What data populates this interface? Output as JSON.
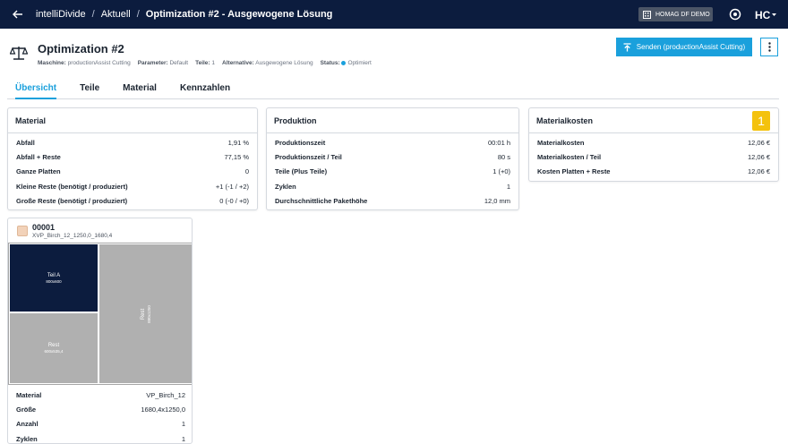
{
  "topbar": {
    "app": "intelliDivide",
    "crumb": "Aktuell",
    "current": "Optimization #2 - Ausgewogene Lösung",
    "tenant": "HOMAG DF DEMO"
  },
  "header": {
    "title": "Optimization #2",
    "meta": [
      {
        "label": "Maschine:",
        "value": "productionAssist Cutting"
      },
      {
        "label": "Parameter:",
        "value": "Default"
      },
      {
        "label": "Teile:",
        "value": "1"
      },
      {
        "label": "Alternative:",
        "value": "Ausgewogene Lösung"
      },
      {
        "label": "Status:",
        "value": "Optimiert"
      }
    ],
    "send_label": "Senden (productionAssist Cutting)"
  },
  "tabs": [
    "Übersicht",
    "Teile",
    "Material",
    "Kennzahlen"
  ],
  "cards": {
    "material": {
      "title": "Material",
      "rows": [
        {
          "k": "Abfall",
          "v": "1,91 %"
        },
        {
          "k": "Abfall + Reste",
          "v": "77,15 %"
        },
        {
          "k": "Ganze Platten",
          "v": "0"
        },
        {
          "k": "Kleine Reste (benötigt / produziert)",
          "v": "+1 (-1 / +2)"
        },
        {
          "k": "Große Reste (benötigt / produziert)",
          "v": "0 (-0 / +0)"
        }
      ]
    },
    "produktion": {
      "title": "Produktion",
      "rows": [
        {
          "k": "Produktionszeit",
          "v": "00:01 h"
        },
        {
          "k": "Produktionszeit / Teil",
          "v": "80 s"
        },
        {
          "k": "Teile (Plus Teile)",
          "v": "1 (+0)"
        },
        {
          "k": "Zyklen",
          "v": "1"
        },
        {
          "k": "Durchschnittliche Pakethöhe",
          "v": "12,0 mm"
        }
      ]
    },
    "kosten": {
      "title": "Materialkosten",
      "badge": "1",
      "rows": [
        {
          "k": "Materialkosten",
          "v": "12,06 €"
        },
        {
          "k": "Materialkosten / Teil",
          "v": "12,06 €"
        },
        {
          "k": "Kosten Platten + Reste",
          "v": "12,06 €"
        }
      ]
    }
  },
  "plate": {
    "id": "00001",
    "sub": "XVP_Birch_12_1250,0_1680,4",
    "pieces": {
      "teil": {
        "label": "Teil A",
        "size": "800x600"
      },
      "rest1": {
        "label": "Rest",
        "size": "600x535,4"
      },
      "rest2": {
        "label": "Rest",
        "size": "880x1250"
      }
    },
    "rows": [
      {
        "k": "Material",
        "v": "VP_Birch_12"
      },
      {
        "k": "Größe",
        "v": "1680,4x1250,0"
      },
      {
        "k": "Anzahl",
        "v": "1"
      },
      {
        "k": "Zyklen",
        "v": "1"
      }
    ]
  },
  "colors": {
    "topbar": "#0c1c3e",
    "accent": "#1aa0dc",
    "badge": "#f4c20d",
    "part": "#0c1c3e",
    "rest": "#b0b0b0"
  }
}
